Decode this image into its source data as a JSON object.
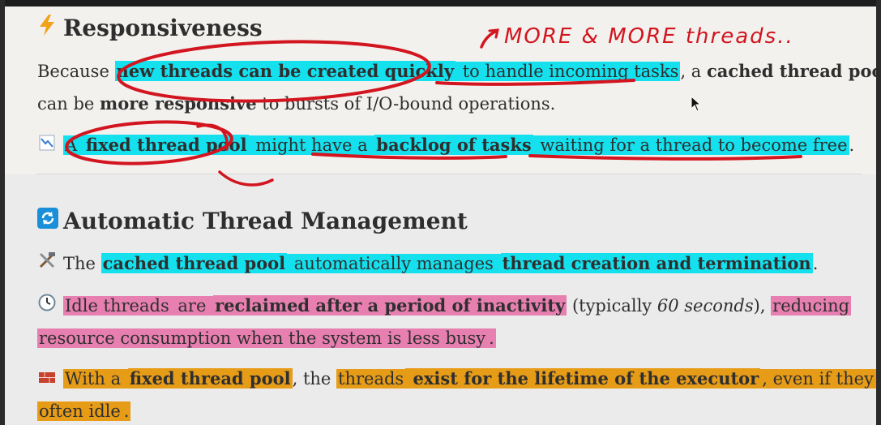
{
  "section1": {
    "heading_icon": "lightning-icon",
    "heading": "Responsiveness",
    "para1": {
      "t1": "Because ",
      "t2": "new threads can be created quickly",
      "t3": " to handle incoming tasks",
      "t4": ", a ",
      "t5": "cached thread pool",
      "t6": "can be ",
      "t7": "more responsive",
      "t8": " to bursts of I/O-bound operations."
    },
    "para2": {
      "icon": "chart-down-icon",
      "t1": "A ",
      "t2": "fixed thread pool",
      "t3": " might have a ",
      "t4": "backlog of tasks",
      "t5": " waiting for a thread to become free",
      "t6": "."
    },
    "annotation_text": "MORE & MORE threads.."
  },
  "section2": {
    "heading_icon": "refresh-icon",
    "heading": "Automatic Thread Management",
    "item1": {
      "icon": "tools-icon",
      "t1": "The ",
      "t2": "cached thread pool",
      "t3": " automatically manages ",
      "t4": "thread creation and termination",
      "t5": "."
    },
    "item2": {
      "icon": "clock-icon",
      "t1": "Idle threads",
      "t2": " are ",
      "t3": "reclaimed after a period of inactivity",
      "t4": " (typically ",
      "t5": "60 seconds",
      "t6": "), ",
      "t7": "reducing",
      "t8": "resource consumption when the system is less busy",
      "t9": "."
    },
    "item3": {
      "icon": "brick-icon",
      "t1": "With a ",
      "t2": "fixed thread pool",
      "t3": ", the ",
      "t4": "threads",
      "t5": " exist for the lifetime of the executor",
      "t6": ", even if they are",
      "t7": "often idle",
      "t8": "."
    }
  },
  "colors": {
    "highlight_cyan": "#14e0ee",
    "highlight_pink": "#e77fb0",
    "highlight_orange": "#e79c18",
    "annotation_red": "#d2151f"
  }
}
